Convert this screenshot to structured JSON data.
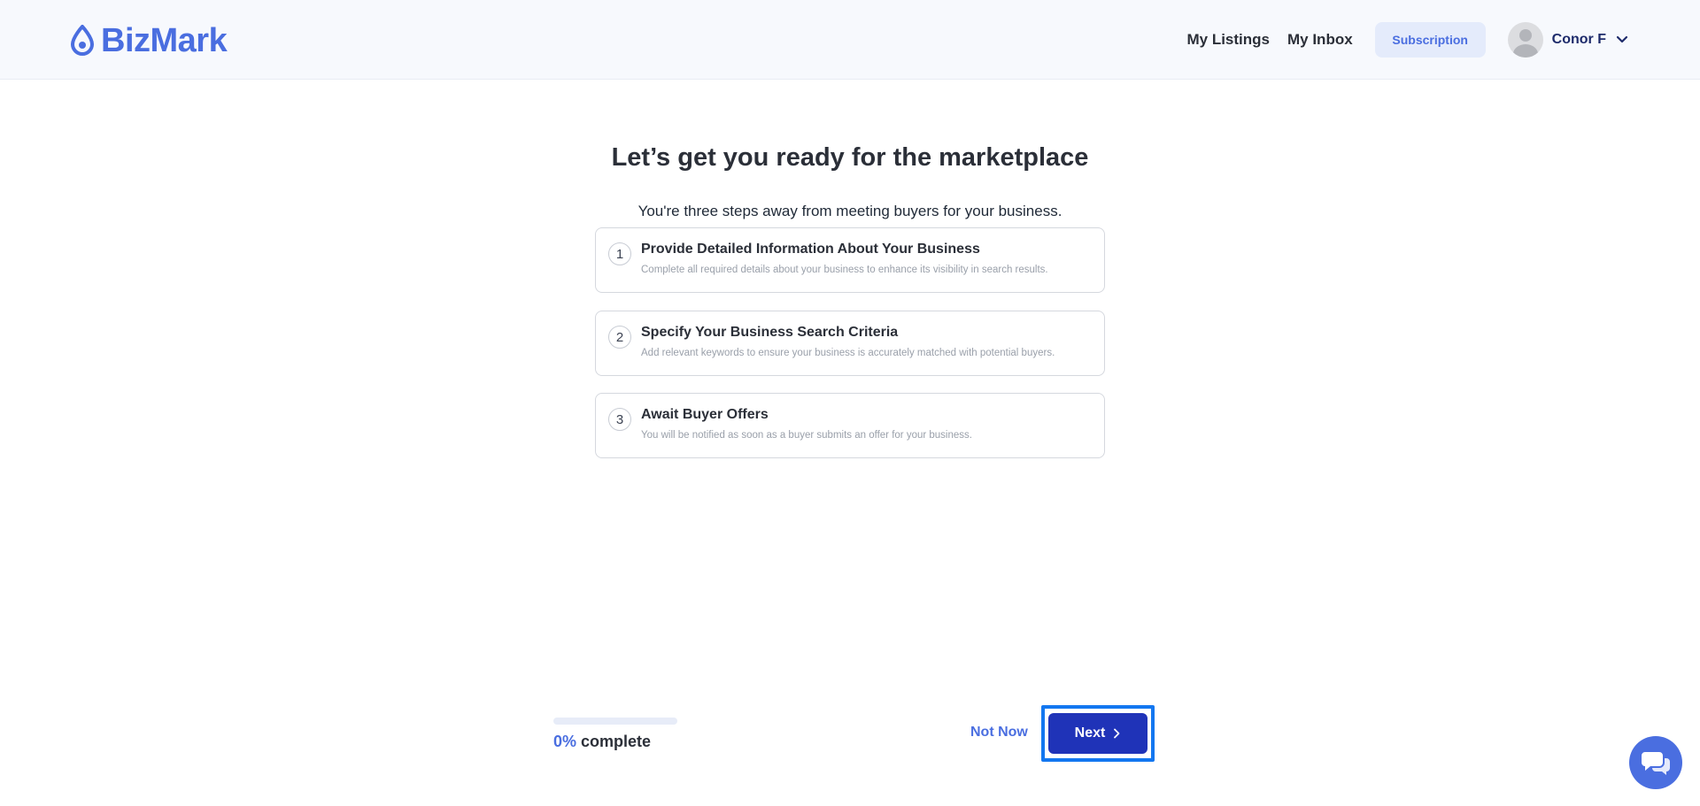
{
  "brand": {
    "name": "BizMark",
    "color": "#4a6ee0"
  },
  "nav": {
    "my_listings": "My Listings",
    "my_inbox": "My Inbox",
    "subscription": "Subscription",
    "user_name": "Conor F"
  },
  "main": {
    "title": "Let’s get you ready for the marketplace",
    "subtitle": "You're three steps away from meeting buyers for your business.",
    "steps": [
      {
        "number": "1",
        "title": "Provide Detailed Information About Your Business",
        "description": "Complete all required details about your business to enhance its visibility in search results."
      },
      {
        "number": "2",
        "title": "Specify Your Business Search Criteria",
        "description": "Add relevant keywords to ensure your business is accurately matched with potential buyers."
      },
      {
        "number": "3",
        "title": "Await Buyer Offers",
        "description": "You will be notified as soon as a buyer submits an offer for your business."
      }
    ]
  },
  "footer": {
    "progress_percent": 0,
    "progress_value": "0%",
    "progress_suffix": "complete",
    "not_now": "Not Now",
    "next": "Next"
  },
  "icons": {
    "logo": "bizmark-drop-icon",
    "chevron": "chevron-down-icon",
    "next_arrow": "chevron-right-icon",
    "chat": "chat-bubbles-icon"
  },
  "colors": {
    "accent": "#4a6ee0",
    "next_button": "#1f33b8",
    "focus_outline": "#1377f0"
  }
}
